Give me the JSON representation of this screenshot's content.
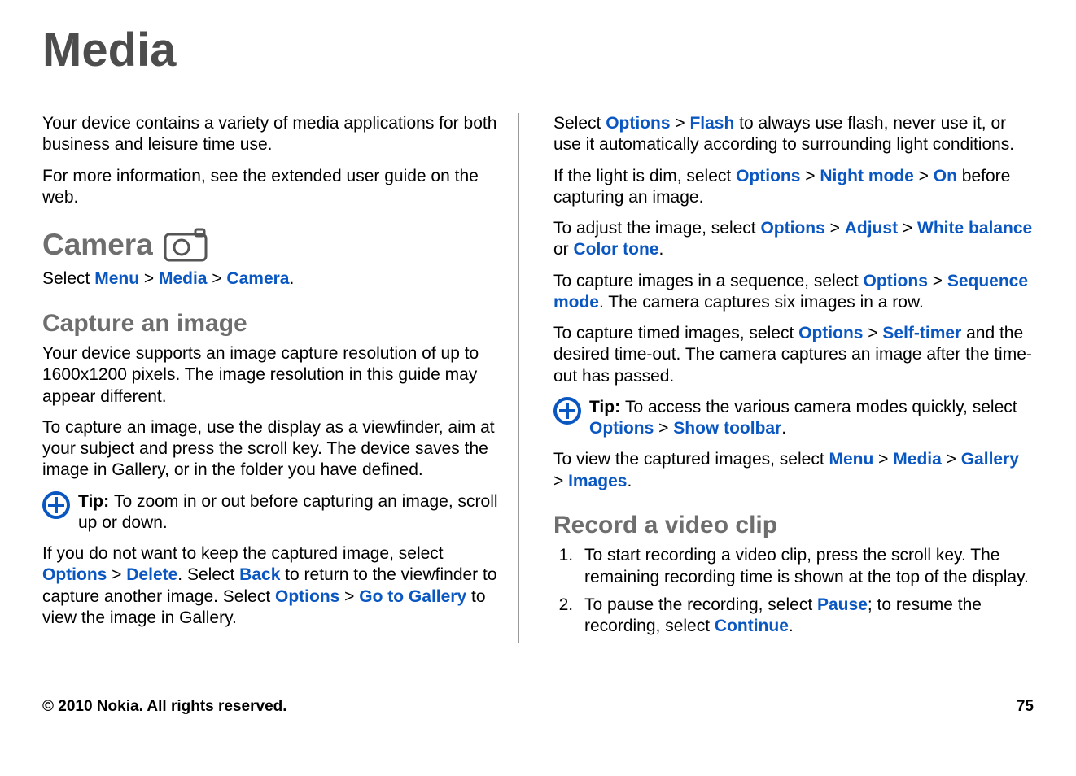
{
  "title": "Media",
  "intro1": "Your device contains a variety of media applications for both business and leisure time use.",
  "intro2": "For more information, see the extended user guide on the web.",
  "camera": {
    "heading": "Camera",
    "select_pre": "Select ",
    "menu": "Menu",
    "media": "Media",
    "camera": "Camera",
    "gt": " > ",
    "period": "."
  },
  "capture": {
    "heading": "Capture an image",
    "p1": "Your device supports an image capture resolution of up to 1600x1200 pixels. The image resolution in this guide may appear different.",
    "p2": "To capture an image, use the display as a viewfinder, aim at your subject and press the scroll key. The device saves the image in Gallery, or in the folder you have defined.",
    "tip_label": "Tip:  ",
    "tip1": "To zoom in or out before capturing an image, scroll up or down.",
    "keep_pre": "If you do not want to keep the captured image, select ",
    "options": "Options",
    "delete": "Delete",
    "keep_mid1": ". Select ",
    "back": "Back",
    "keep_mid2": " to return to the viewfinder to capture another image. Select ",
    "goto_gallery": "Go to Gallery",
    "keep_post": " to view the image in Gallery."
  },
  "right": {
    "flash_pre": "Select ",
    "options": "Options",
    "gt": " > ",
    "flash": "Flash",
    "flash_post": " to always use flash, never use it, or use it automatically according to surrounding light conditions.",
    "dim_pre": "If the light is dim, select ",
    "night_mode": "Night mode",
    "on": "On",
    "dim_post": " before capturing an image.",
    "adjust_pre": "To adjust the image, select ",
    "adjust": "Adjust",
    "white_balance": "White balance",
    "or": " or ",
    "color_tone": "Color tone",
    "adjust_post": ".",
    "seq_pre": "To capture images in a sequence, select ",
    "sequence_mode": "Sequence mode",
    "seq_post": ". The camera captures six images in a row.",
    "timer_pre": "To capture timed images, select ",
    "self_timer": "Self-timer",
    "timer_post": " and the desired time-out. The camera captures an image after the time-out has passed.",
    "tip_label": "Tip: ",
    "tip2_pre": "To access the various camera modes quickly, select ",
    "show_toolbar": "Show toolbar",
    "tip2_post": ".",
    "view_pre": "To view the captured images, select ",
    "menu": "Menu",
    "media": "Media",
    "gallery": "Gallery",
    "images": "Images",
    "view_post": "."
  },
  "record": {
    "heading": "Record a video clip",
    "li1": "To start recording a video clip, press the scroll key. The remaining recording time is shown at the top of the display.",
    "li2_pre": "To pause the recording, select ",
    "pause": "Pause",
    "li2_mid": "; to resume the recording, select ",
    "continue": "Continue",
    "li2_post": "."
  },
  "footer": {
    "copyright": "© 2010 Nokia. All rights reserved.",
    "page": "75"
  }
}
